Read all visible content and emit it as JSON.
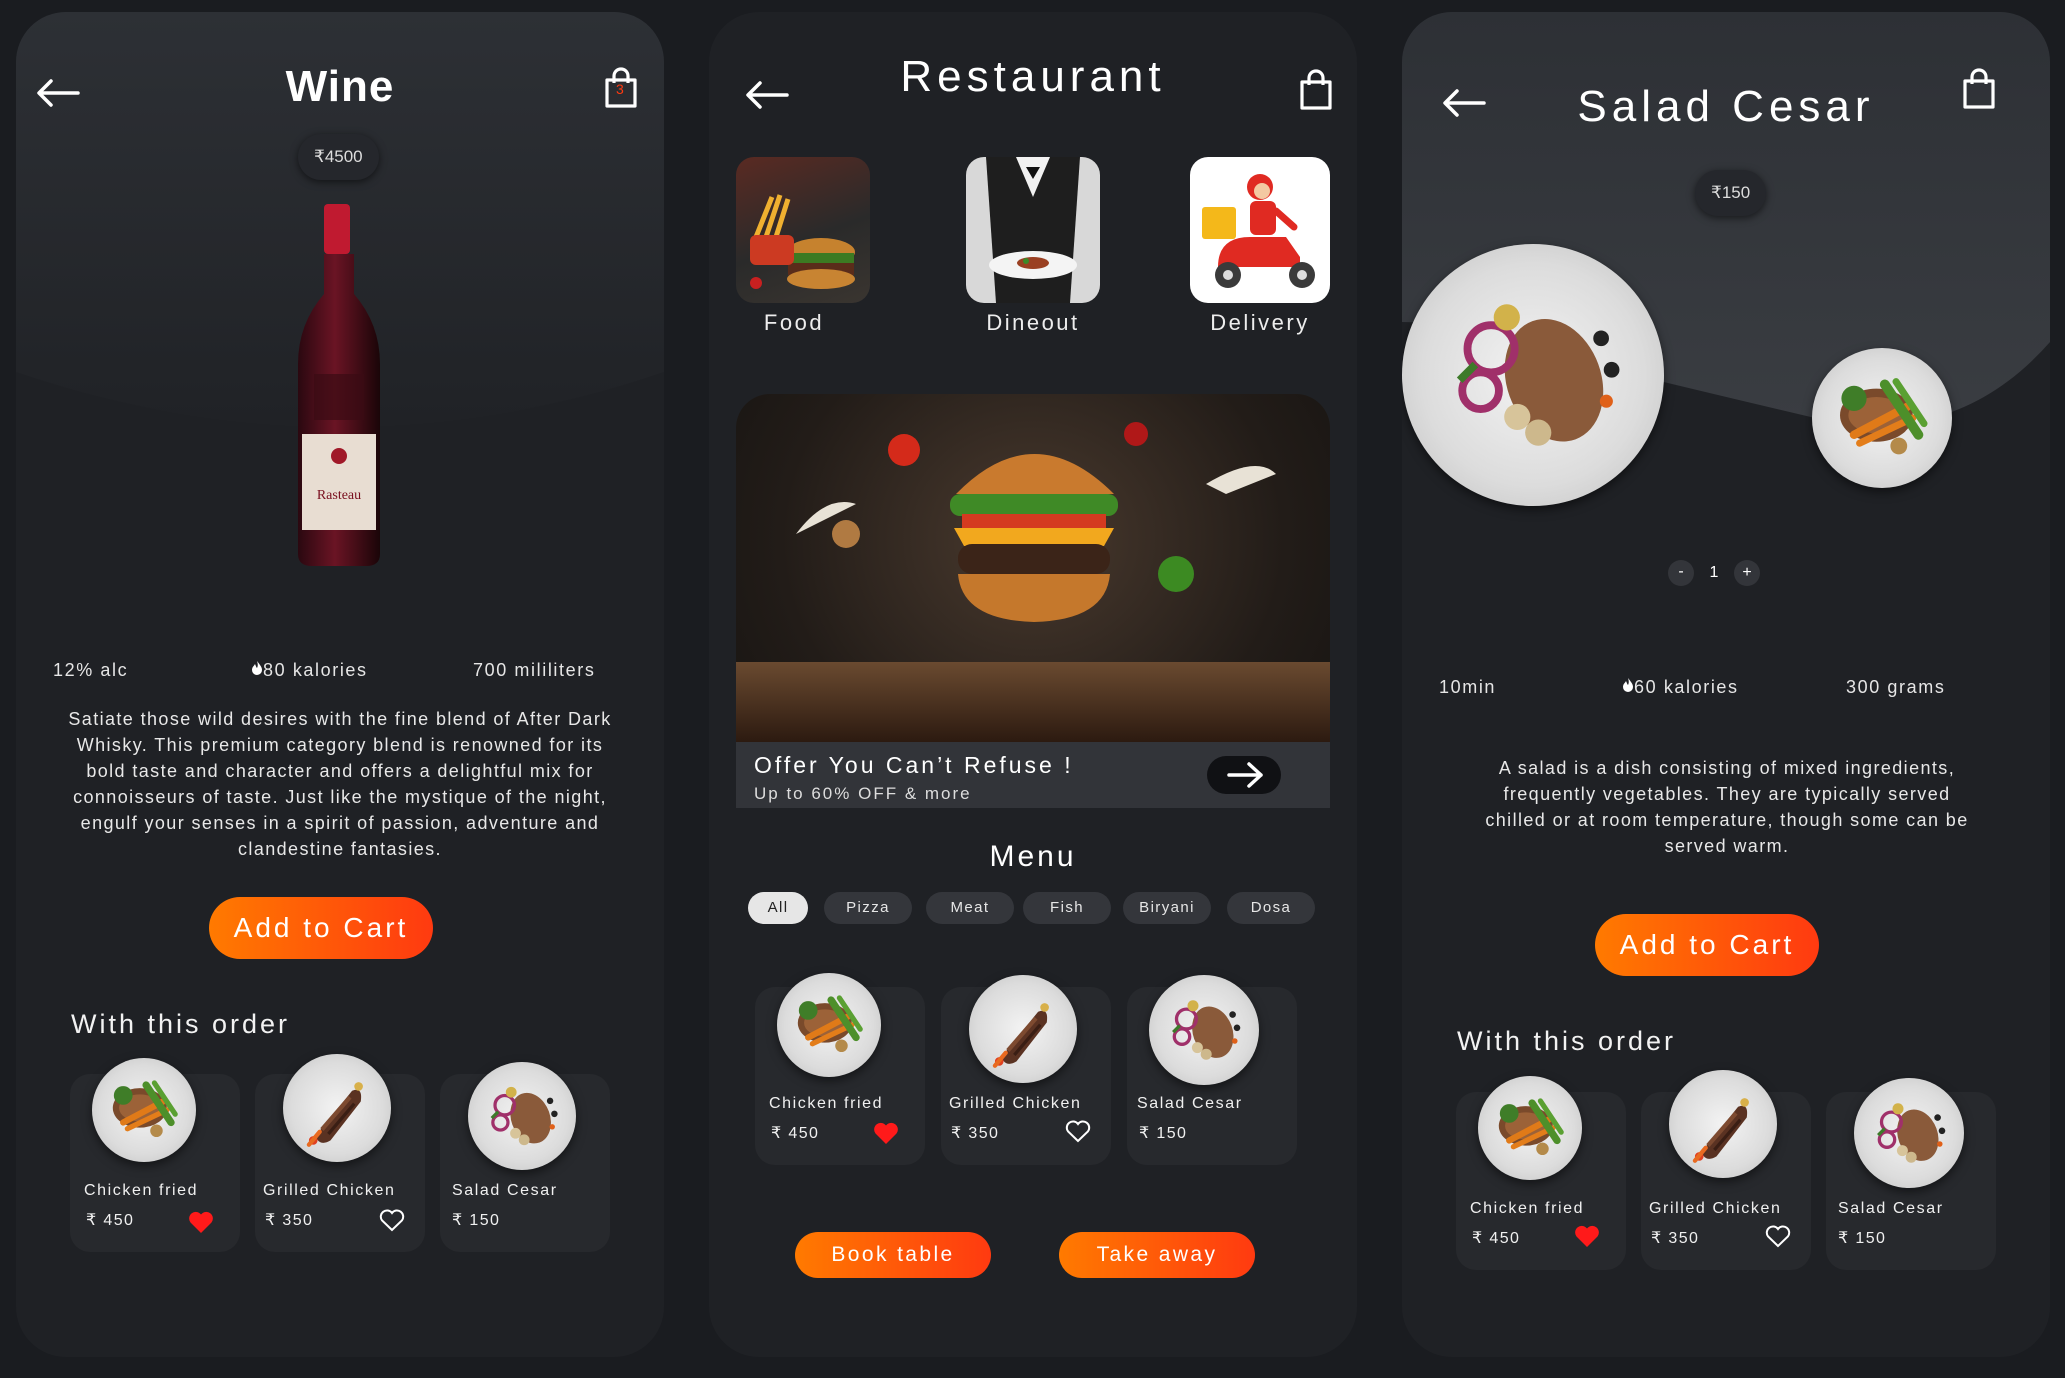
{
  "colors": {
    "accent_start": "#ff7a00",
    "accent_end": "#ff3a10",
    "background": "#1a1c20",
    "card": "#27292d",
    "heart": "#ff1a1a"
  },
  "wine": {
    "title": "Wine",
    "price": "₹4500",
    "cart_count": "3",
    "bottle_label": "Rasteau",
    "stats": {
      "alc": "12% alc",
      "kalories": "80 kalories",
      "volume": "700 mililiters"
    },
    "description": "Satiate those wild desires with the fine blend of After Dark Whisky. This premium category blend is renowned for its bold taste and character and offers a delightful mix for connoisseurs of taste. Just like the mystique of the night, engulf your senses in a spirit of passion, adventure and clandestine fantasies.",
    "cta": "Add to Cart",
    "section": "With this order",
    "items": [
      {
        "name": "Chicken fried",
        "price": "₹ 450",
        "liked": true
      },
      {
        "name": "Grilled Chicken",
        "price": "₹ 350",
        "liked": false
      },
      {
        "name": "Salad Cesar",
        "price": "₹ 150",
        "liked": false
      }
    ]
  },
  "restaurant": {
    "title": "Restaurant",
    "categories": [
      {
        "label": "Food"
      },
      {
        "label": "Dineout"
      },
      {
        "label": "Delivery"
      }
    ],
    "offer": {
      "title": "Offer You Can’t Refuse !",
      "subtitle": "Up to 60% OFF & more"
    },
    "menu_title": "Menu",
    "filters": [
      "All",
      "Pizza",
      "Meat",
      "Fish",
      "Biryani",
      "Dosa"
    ],
    "active_filter": "All",
    "items": [
      {
        "name": "Chicken fried",
        "price": "₹ 450",
        "liked": true
      },
      {
        "name": "Grilled Chicken",
        "price": "₹ 350",
        "liked": false
      },
      {
        "name": "Salad Cesar",
        "price": "₹ 150",
        "liked": false
      }
    ],
    "book_label": "Book table",
    "takeaway_label": "Take away"
  },
  "salad": {
    "title": "Salad Cesar",
    "price": "₹150",
    "quantity": "1",
    "minus": "-",
    "plus": "+",
    "stats": {
      "time": "10min",
      "kalories": "60 kalories",
      "weight": "300 grams"
    },
    "description": "A salad is a dish consisting of mixed ingredients, frequently vegetables. They are typically served chilled or at room temperature, though some can be served warm.",
    "cta": "Add to Cart",
    "section": "With this order",
    "items": [
      {
        "name": "Chicken fried",
        "price": "₹ 450",
        "liked": true
      },
      {
        "name": "Grilled Chicken",
        "price": "₹ 350",
        "liked": false
      },
      {
        "name": "Salad Cesar",
        "price": "₹ 150",
        "liked": false
      }
    ]
  }
}
